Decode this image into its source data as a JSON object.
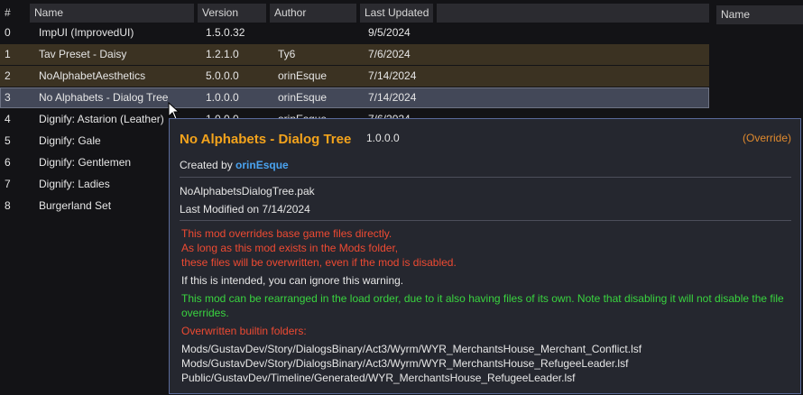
{
  "table": {
    "headers": [
      "#",
      "Name",
      "Version",
      "Author",
      "Last Updated"
    ],
    "right_header": "Name",
    "rows": [
      {
        "index": "0",
        "name": "ImpUI (ImprovedUI)",
        "version": "1.5.0.32",
        "author": "",
        "updated": "9/5/2024"
      },
      {
        "index": "1",
        "name": "Tav Preset - Daisy",
        "version": "1.2.1.0",
        "author": "Ty6",
        "updated": "7/6/2024"
      },
      {
        "index": "2",
        "name": "NoAlphabetAesthetics",
        "version": "5.0.0.0",
        "author": "orinEsque",
        "updated": "7/14/2024"
      },
      {
        "index": "3",
        "name": "No Alphabets - Dialog Tree",
        "version": "1.0.0.0",
        "author": "orinEsque",
        "updated": "7/14/2024"
      },
      {
        "index": "4",
        "name": "Dignify: Astarion (Leather)",
        "version": "1.0.0.0",
        "author": "orinEsque",
        "updated": "7/6/2024"
      },
      {
        "index": "5",
        "name": "Dignify: Gale",
        "version": "",
        "author": "",
        "updated": ""
      },
      {
        "index": "6",
        "name": "Dignify: Gentlemen",
        "version": "",
        "author": "",
        "updated": ""
      },
      {
        "index": "7",
        "name": "Dignify: Ladies",
        "version": "",
        "author": "",
        "updated": ""
      },
      {
        "index": "8",
        "name": "Burgerland Set",
        "version": "",
        "author": "",
        "updated": ""
      }
    ]
  },
  "tooltip": {
    "title": "No Alphabets - Dialog Tree",
    "version": "1.0.0.0",
    "override_tag": "(Override)",
    "created_by_label": "Created by",
    "author": "orinEsque",
    "file": "NoAlphabetsDialogTree.pak",
    "modified": "Last Modified on 7/14/2024",
    "warning_lines": [
      "This mod overrides base game files directly.",
      "As long as this mod exists in the Mods folder,",
      "these files will be overwritten, even if the mod is disabled."
    ],
    "ignore_line": "If this is intended, you can ignore this warning.",
    "green_lines": [
      "This mod can be rearranged in the load order, due to it also having files of its own. Note that disabling it will not disable the file",
      "overrides."
    ],
    "folders_label": "Overwritten builtin folders:",
    "folders": [
      "Mods/GustavDev/Story/DialogsBinary/Act3/Wyrm/WYR_MerchantsHouse_Merchant_Conflict.lsf",
      "Mods/GustavDev/Story/DialogsBinary/Act3/Wyrm/WYR_MerchantsHouse_RefugeeLeader.lsf",
      "Public/GustavDev/Timeline/Generated/WYR_MerchantsHouse_RefugeeLeader.lsf"
    ]
  },
  "colors": {
    "row_highlight": "#3b3222",
    "selected_row": "#434858",
    "title": "#f3a31c",
    "warning": "#ee4a32",
    "info": "#39d43f",
    "author_link": "#4aa3f0"
  }
}
